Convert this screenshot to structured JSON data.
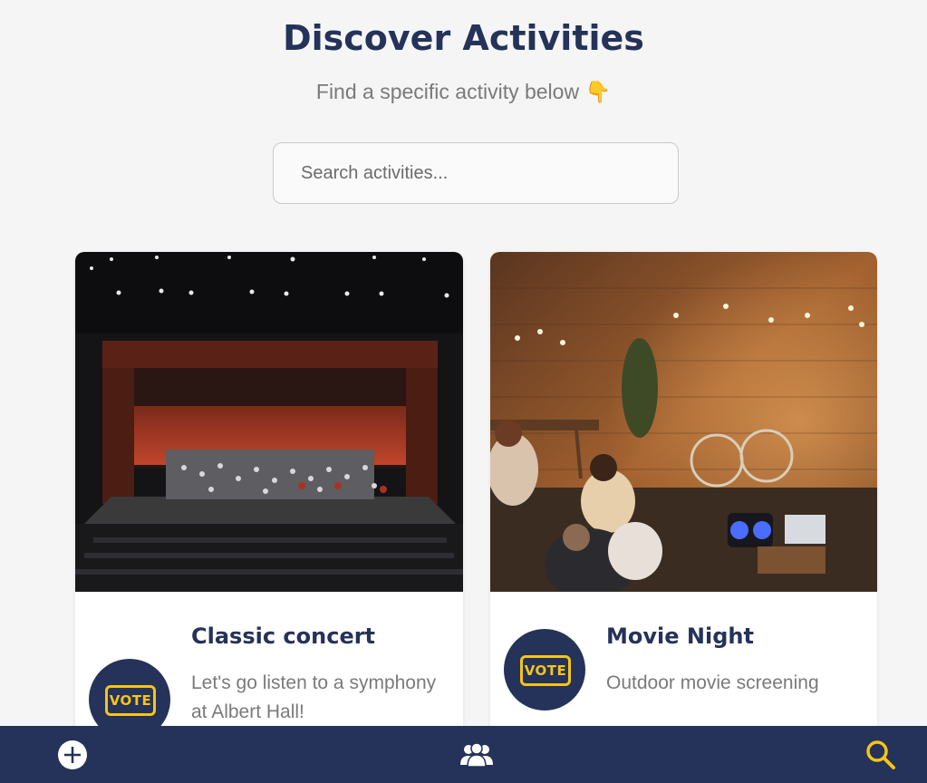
{
  "page": {
    "title": "Discover Activities",
    "subtitle": "Find a specific activity below 👇"
  },
  "search": {
    "placeholder": "Search activities...",
    "value": ""
  },
  "activities": [
    {
      "title": "Classic concert",
      "description": "Let's go listen to a symphony at Albert Hall!",
      "badge": "VOTE",
      "image_subject": "concert-hall"
    },
    {
      "title": "Movie Night",
      "description": "Outdoor movie screening",
      "badge": "VOTE",
      "image_subject": "outdoor-movie-night"
    }
  ],
  "bottom_nav": {
    "items": [
      {
        "icon": "plus-circle-icon"
      },
      {
        "icon": "group-icon"
      },
      {
        "icon": "search-icon"
      }
    ]
  },
  "colors": {
    "primary": "#253259",
    "accent": "#f5c518",
    "background": "#f5f5f5",
    "muted_text": "#7a7a7a"
  }
}
